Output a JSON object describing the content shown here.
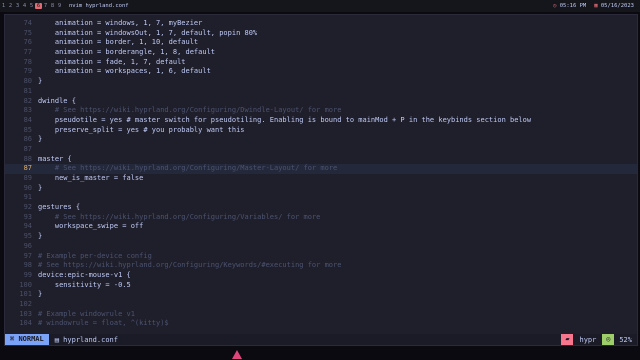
{
  "topbar": {
    "workspaces": [
      "1",
      "2",
      "3",
      "4",
      "5",
      "6",
      "7",
      "8",
      "9"
    ],
    "active_workspace": "6",
    "title": "nvim hyprland.conf",
    "time": "05:16 PM",
    "date": "05/16/2023",
    "accent_color": "#e06c75"
  },
  "editor": {
    "lines": [
      {
        "n": "74",
        "text": "    animation = windows, 1, 7, myBezier"
      },
      {
        "n": "75",
        "text": "    animation = windowsOut, 1, 7, default, popin 80%"
      },
      {
        "n": "76",
        "text": "    animation = border, 1, 10, default"
      },
      {
        "n": "77",
        "text": "    animation = borderangle, 1, 8, default"
      },
      {
        "n": "78",
        "text": "    animation = fade, 1, 7, default"
      },
      {
        "n": "79",
        "text": "    animation = workspaces, 1, 6, default"
      },
      {
        "n": "80",
        "text": "}"
      },
      {
        "n": "81",
        "text": ""
      },
      {
        "n": "82",
        "text": "dwindle {"
      },
      {
        "n": "83",
        "text": "    # See https://wiki.hyprland.org/Configuring/Dwindle-Layout/ for more",
        "comment": true
      },
      {
        "n": "84",
        "text": "    pseudotile = yes # master switch for pseudotiling. Enabling is bound to mainMod + P in the keybinds section below"
      },
      {
        "n": "85",
        "text": "    preserve_split = yes # you probably want this"
      },
      {
        "n": "86",
        "text": "}"
      },
      {
        "n": "87",
        "text": ""
      },
      {
        "n": "88",
        "text": "master {"
      },
      {
        "n": "87",
        "text": "    # See https://wiki.hyprland.org/Configuring/Master-Layout/ for more",
        "comment": true,
        "current": true
      },
      {
        "n": "89",
        "text": "    new_is_master = false"
      },
      {
        "n": "90",
        "text": "}"
      },
      {
        "n": "91",
        "text": ""
      },
      {
        "n": "92",
        "text": "gestures {"
      },
      {
        "n": "93",
        "text": "    # See https://wiki.hyprland.org/Configuring/Variables/ for more",
        "comment": true
      },
      {
        "n": "94",
        "text": "    workspace_swipe = off"
      },
      {
        "n": "95",
        "text": "}"
      },
      {
        "n": "96",
        "text": ""
      },
      {
        "n": "97",
        "text": "# Example per-device config",
        "comment": true
      },
      {
        "n": "98",
        "text": "# See https://wiki.hyprland.org/Configuring/Keywords/#executing for more",
        "comment": true
      },
      {
        "n": "99",
        "text": "device:epic-mouse-v1 {"
      },
      {
        "n": "100",
        "text": "    sensitivity = -0.5"
      },
      {
        "n": "101",
        "text": "}"
      },
      {
        "n": "102",
        "text": ""
      },
      {
        "n": "103",
        "text": "# Example windowrule v1",
        "comment": true
      },
      {
        "n": "104",
        "text": "# windowrule = float, ^(kitty)$",
        "comment": true
      }
    ]
  },
  "statusline": {
    "mode": "NORMAL",
    "filename": "hyprland.conf",
    "filetype": "hypr",
    "percent": "52%"
  }
}
